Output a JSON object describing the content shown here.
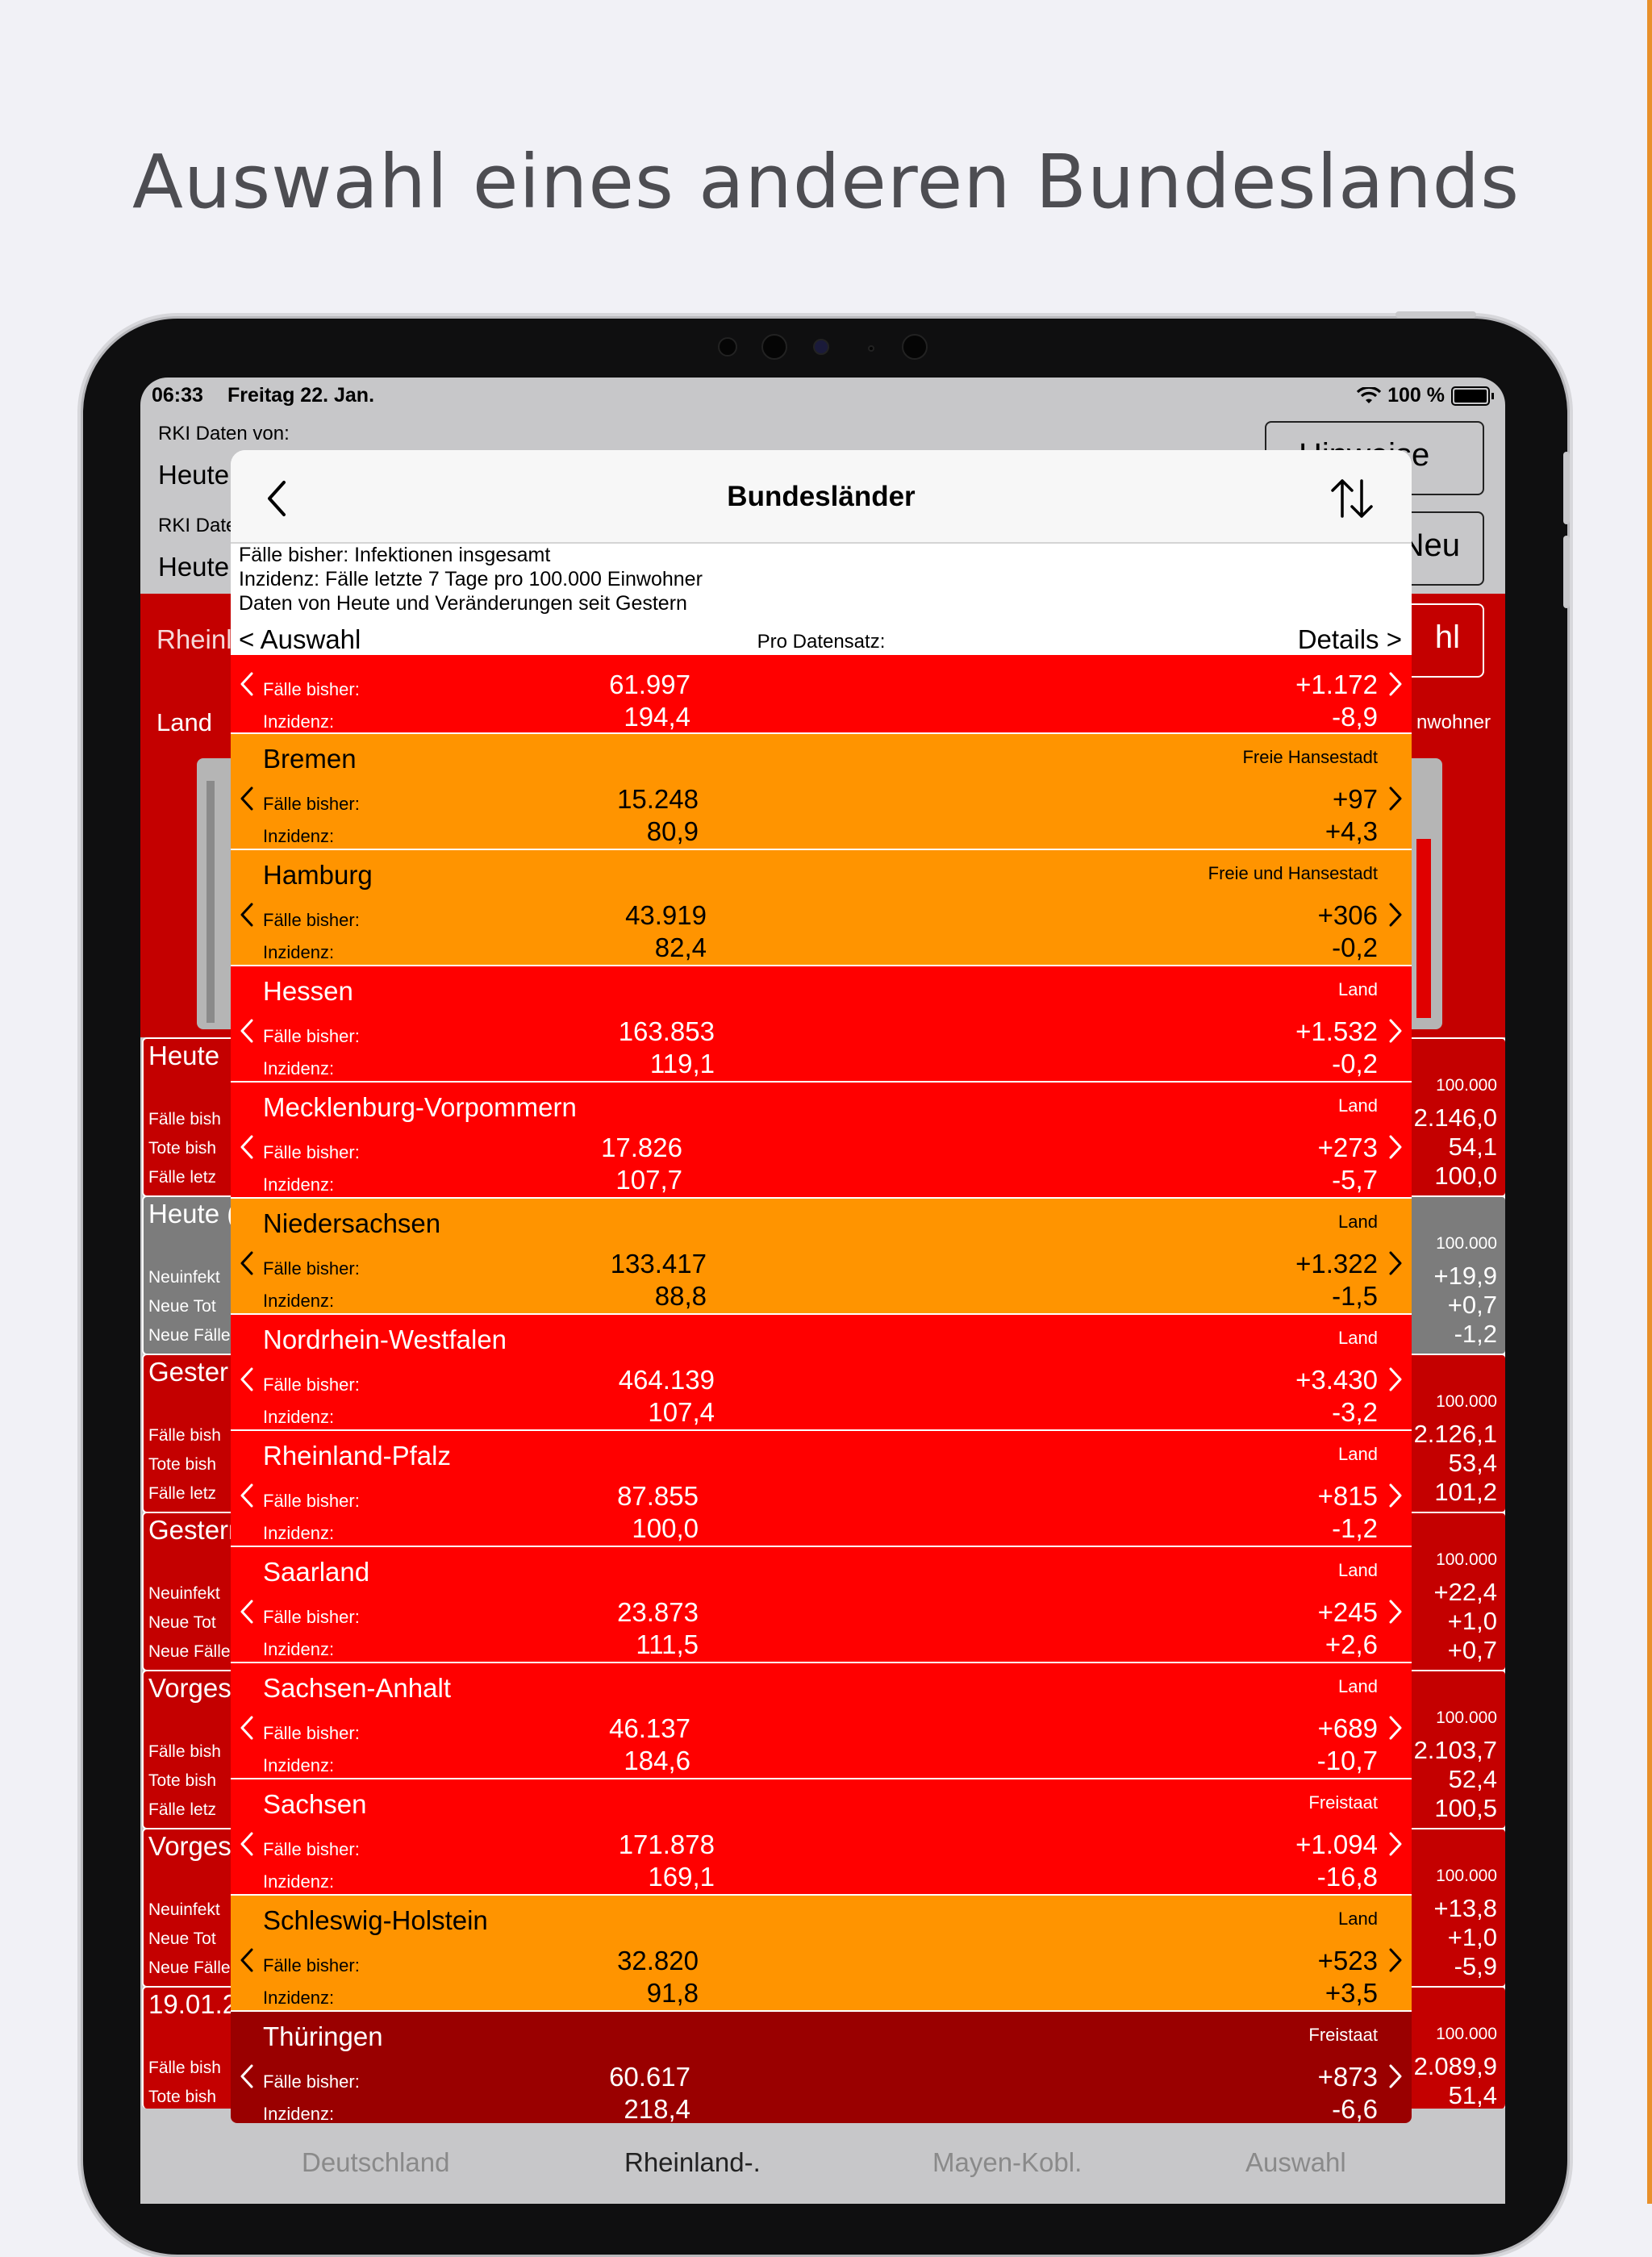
{
  "headline": "Auswahl eines anderen Bundeslands",
  "status_bar": {
    "time": "06:33",
    "date": "Freitag 22. Jan.",
    "battery": "100 %"
  },
  "background": {
    "rki_label_1": "RKI Daten von:",
    "rki_value_1": "Heute",
    "rki_label_2": "RKI Date",
    "rki_value_2": "Heute",
    "btn_hinweise": "Hinweise",
    "btn_neu": "Neu",
    "btn_auswahl": "hl",
    "region_title": "Rheinl",
    "land_label": "Land",
    "einwohner_label": "nwohner",
    "cards": [
      {
        "title": "Heute",
        "color": "#c40000",
        "labels": [
          "Fälle bish",
          "Tote bish",
          "Fälle letz"
        ],
        "header": "100.000",
        "values": [
          "2.146,0",
          "54,1",
          "100,0"
        ]
      },
      {
        "title": "Heute (",
        "color": "#7c7c7c",
        "labels": [
          "Neuinfekt",
          "Neue Tot",
          "Neue Fälle"
        ],
        "header": "100.000",
        "values": [
          "+19,9",
          "+0,7",
          "-1,2"
        ]
      },
      {
        "title": "Gester",
        "color": "#c40000",
        "labels": [
          "Fälle bish",
          "Tote bish",
          "Fälle letz"
        ],
        "header": "100.000",
        "values": [
          "2.126,1",
          "53,4",
          "101,2"
        ]
      },
      {
        "title": "Gestern",
        "color": "#c40000",
        "labels": [
          "Neuinfekt",
          "Neue Tot",
          "Neue Fälle"
        ],
        "header": "100.000",
        "values": [
          "+22,4",
          "+1,0",
          "+0,7"
        ]
      },
      {
        "title": "Vorges",
        "color": "#c40000",
        "labels": [
          "Fälle bish",
          "Tote bish",
          "Fälle letz"
        ],
        "header": "100.000",
        "values": [
          "2.103,7",
          "52,4",
          "100,5"
        ]
      },
      {
        "title": "Vorges",
        "color": "#c40000",
        "labels": [
          "Neuinfekt",
          "Neue Tot",
          "Neue Fälle"
        ],
        "header": "100.000",
        "values": [
          "+13,8",
          "+1,0",
          "-5,9"
        ]
      },
      {
        "title": "19.01.2",
        "color": "#c40000",
        "labels": [
          "Fälle bish",
          "Tote bish",
          ""
        ],
        "header": "100.000",
        "values": [
          "2.089,9",
          "51,4",
          ""
        ]
      }
    ],
    "tabs": [
      "Deutschland",
      "Rheinland-.",
      "Mayen-Kobl.",
      "Auswahl"
    ]
  },
  "modal": {
    "title": "Bundesländer",
    "info_lines": [
      "Fälle bisher: Infektionen insgesamt",
      "Inzidenz: Fälle letzte 7 Tage pro 100.000 Einwohner",
      "Daten von Heute und Veränderungen seit Gestern"
    ],
    "header": {
      "left": "< Auswahl",
      "middle": "Pro Datensatz:",
      "right": "Details >"
    },
    "label_cases": "Fälle bisher:",
    "label_incidence": "Inzidenz:",
    "rows": [
      {
        "name": "",
        "type": "",
        "color": "#ff0000",
        "cases": "61.997",
        "incidence": "194,4",
        "d_cases": "+1.172",
        "d_incidence": "-8,9"
      },
      {
        "name": "Bremen",
        "type": "Freie Hansestadt",
        "color": "#ff9400",
        "cases": "15.248",
        "incidence": "80,9",
        "d_cases": "+97",
        "d_incidence": "+4,3"
      },
      {
        "name": "Hamburg",
        "type": "Freie und Hansestadt",
        "color": "#ff9400",
        "cases": "43.919",
        "incidence": "82,4",
        "d_cases": "+306",
        "d_incidence": "-0,2"
      },
      {
        "name": "Hessen",
        "type": "Land",
        "color": "#ff0000",
        "cases": "163.853",
        "incidence": "119,1",
        "d_cases": "+1.532",
        "d_incidence": "-0,2"
      },
      {
        "name": "Mecklenburg-Vorpommern",
        "type": "Land",
        "color": "#ff0000",
        "cases": "17.826",
        "incidence": "107,7",
        "d_cases": "+273",
        "d_incidence": "-5,7"
      },
      {
        "name": "Niedersachsen",
        "type": "Land",
        "color": "#ff9400",
        "cases": "133.417",
        "incidence": "88,8",
        "d_cases": "+1.322",
        "d_incidence": "-1,5"
      },
      {
        "name": "Nordrhein-Westfalen",
        "type": "Land",
        "color": "#ff0000",
        "cases": "464.139",
        "incidence": "107,4",
        "d_cases": "+3.430",
        "d_incidence": "-3,2"
      },
      {
        "name": "Rheinland-Pfalz",
        "type": "Land",
        "color": "#ff0000",
        "cases": "87.855",
        "incidence": "100,0",
        "d_cases": "+815",
        "d_incidence": "-1,2"
      },
      {
        "name": "Saarland",
        "type": "Land",
        "color": "#ff0000",
        "cases": "23.873",
        "incidence": "111,5",
        "d_cases": "+245",
        "d_incidence": "+2,6"
      },
      {
        "name": "Sachsen-Anhalt",
        "type": "Land",
        "color": "#ff0000",
        "cases": "46.137",
        "incidence": "184,6",
        "d_cases": "+689",
        "d_incidence": "-10,7"
      },
      {
        "name": "Sachsen",
        "type": "Freistaat",
        "color": "#ff0000",
        "cases": "171.878",
        "incidence": "169,1",
        "d_cases": "+1.094",
        "d_incidence": "-16,8"
      },
      {
        "name": "Schleswig-Holstein",
        "type": "Land",
        "color": "#ff9400",
        "cases": "32.820",
        "incidence": "91,8",
        "d_cases": "+523",
        "d_incidence": "+3,5"
      },
      {
        "name": "Thüringen",
        "type": "Freistaat",
        "color": "#9a0000",
        "cases": "60.617",
        "incidence": "218,4",
        "d_cases": "+873",
        "d_incidence": "-6,6"
      }
    ]
  }
}
